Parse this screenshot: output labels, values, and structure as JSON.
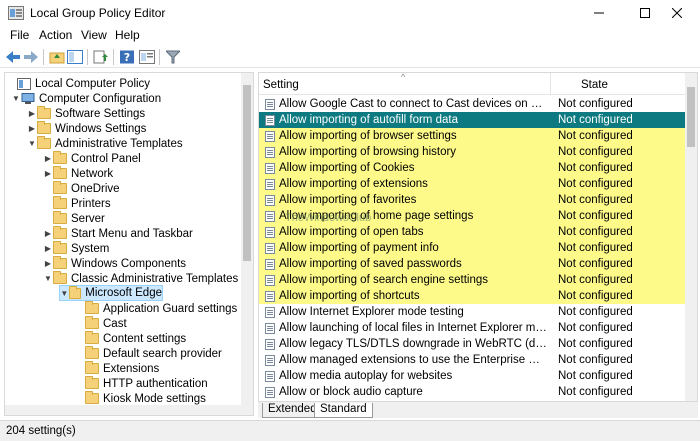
{
  "window": {
    "title": "Local Group Policy Editor"
  },
  "menu": [
    "File",
    "Action",
    "View",
    "Help"
  ],
  "tree": {
    "items": [
      {
        "label": "Local Computer Policy",
        "level": 0,
        "expanded": true
      },
      {
        "label": "Computer Configuration",
        "level": 1,
        "expanded": true
      },
      {
        "label": "Software Settings",
        "level": 2,
        "expanded": false
      },
      {
        "label": "Windows Settings",
        "level": 2,
        "expanded": false
      },
      {
        "label": "Administrative Templates",
        "level": 2,
        "expanded": true
      },
      {
        "label": "Control Panel",
        "level": 3,
        "expanded": false
      },
      {
        "label": "Network",
        "level": 3,
        "expanded": false
      },
      {
        "label": "OneDrive",
        "level": 3
      },
      {
        "label": "Printers",
        "level": 3
      },
      {
        "label": "Server",
        "level": 3
      },
      {
        "label": "Start Menu and Taskbar",
        "level": 3,
        "expanded": false
      },
      {
        "label": "System",
        "level": 3,
        "expanded": false
      },
      {
        "label": "Windows Components",
        "level": 3,
        "expanded": false
      },
      {
        "label": "Classic Administrative Templates (ADM",
        "level": 3,
        "expanded": true
      },
      {
        "label": "Microsoft Edge",
        "level": 4,
        "expanded": true,
        "selected": true
      },
      {
        "label": "Application Guard settings",
        "level": 5
      },
      {
        "label": "Cast",
        "level": 5
      },
      {
        "label": "Content settings",
        "level": 5
      },
      {
        "label": "Default search provider",
        "level": 5
      },
      {
        "label": "Extensions",
        "level": 5
      },
      {
        "label": "HTTP authentication",
        "level": 5
      },
      {
        "label": "Kiosk Mode settings",
        "level": 5
      }
    ]
  },
  "list": {
    "columns": {
      "setting": "Setting",
      "state": "State"
    },
    "rows": [
      {
        "name": "Allow Google Cast to connect to Cast devices on all IP addre...",
        "state": "Not configured",
        "style": "normal"
      },
      {
        "name": "Allow importing of autofill form data",
        "state": "Not configured",
        "style": "selected"
      },
      {
        "name": "Allow importing of browser settings",
        "state": "Not configured",
        "style": "highlight"
      },
      {
        "name": "Allow importing of browsing history",
        "state": "Not configured",
        "style": "highlight"
      },
      {
        "name": "Allow importing of Cookies",
        "state": "Not configured",
        "style": "highlight"
      },
      {
        "name": "Allow importing of extensions",
        "state": "Not configured",
        "style": "highlight"
      },
      {
        "name": "Allow importing of favorites",
        "state": "Not configured",
        "style": "highlight"
      },
      {
        "name": "Allow importing of home page settings",
        "state": "Not configured",
        "style": "highlight"
      },
      {
        "name": "Allow importing of open tabs",
        "state": "Not configured",
        "style": "highlight"
      },
      {
        "name": "Allow importing of payment info",
        "state": "Not configured",
        "style": "highlight"
      },
      {
        "name": "Allow importing of saved passwords",
        "state": "Not configured",
        "style": "highlight"
      },
      {
        "name": "Allow importing of search engine settings",
        "state": "Not configured",
        "style": "highlight"
      },
      {
        "name": "Allow importing of shortcuts",
        "state": "Not configured",
        "style": "highlight"
      },
      {
        "name": "Allow Internet Explorer mode testing",
        "state": "Not configured",
        "style": "normal"
      },
      {
        "name": "Allow launching of local files in Internet Explorer mode",
        "state": "Not configured",
        "style": "normal"
      },
      {
        "name": "Allow legacy TLS/DTLS downgrade in WebRTC (deprecated)",
        "state": "Not configured",
        "style": "normal"
      },
      {
        "name": "Allow managed extensions to use the Enterprise Hardware P...",
        "state": "Not configured",
        "style": "normal"
      },
      {
        "name": "Allow media autoplay for websites",
        "state": "Not configured",
        "style": "normal"
      },
      {
        "name": "Allow or block audio capture",
        "state": "Not configured",
        "style": "normal"
      }
    ]
  },
  "tabs": [
    "Extended",
    "Standard"
  ],
  "status": "204 setting(s)",
  "watermark": "TheWindowsClub",
  "colors": {
    "selected_row": "#0c7a80",
    "highlight_row": "#fdfa8a",
    "tree_selected": "#cce8ff",
    "folder": "#f5d27a"
  }
}
